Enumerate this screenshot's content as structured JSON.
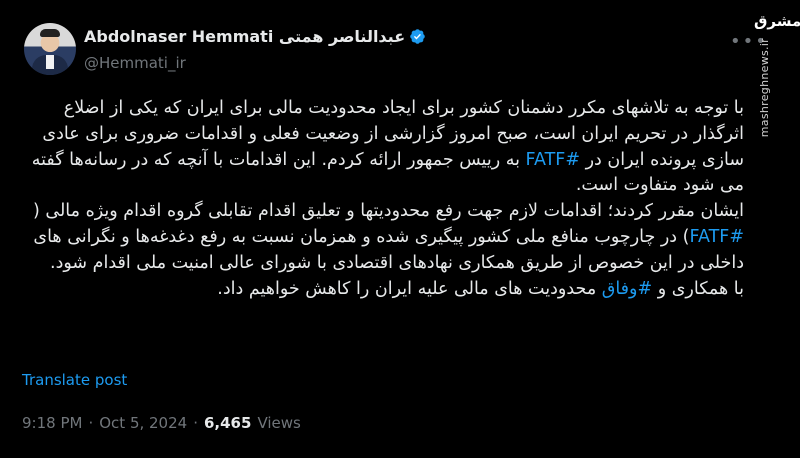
{
  "author": {
    "display_name": "Abdolnaser Hemmati عبدالناصر همتی",
    "handle": "@Hemmati_ir"
  },
  "more_icon": "more-options-icon",
  "verified_icon": "verified-badge-icon",
  "watermark": {
    "logo": "مشرق",
    "url": "mashreghnews.ir"
  },
  "tweet": {
    "p1_a": "با توجه به تلاشهای مکرر دشمنان کشور برای ایجاد محدودیت مالی برای ایران که یکی از اضلاع اثرگذار در تحریم ایران است، صبح امروز گزارشی از وضعیت فعلی و اقدامات ضروری برای عادی سازی پرونده ایران در ",
    "p1_tag": "#FATF",
    "p1_b": " به رییس جمهور ارائه کردم. این اقدامات با آنچه که در رسانه‌ها گفته می شود متفاوت است.",
    "p2_a": "ایشان مقرر کردند؛ اقدامات لازم جهت رفع محدودیتها و تعلیق اقدام تقابلی گروه اقدام ویژه مالی ( ",
    "p2_tag": "#FATF",
    "p2_b": ") در چارچوب منافع ملی کشور پیگیری شده و همزمان نسبت به رفع دغدغه‌ها و نگرانی های داخلی در این خصوص از طریق همکاری نهادهای اقتصادی با شورای عالی امنیت ملی اقدام شود.",
    "p3_a": "با همکاری و ",
    "p3_tag": "#وفاق",
    "p3_b": " محدودیت های مالی علیه ایران را کاهش خواهیم داد."
  },
  "translate_label": "Translate post",
  "meta": {
    "time": "9:18 PM",
    "separator": "·",
    "date": "Oct 5, 2024",
    "views_count": "6,465",
    "views_label": "Views"
  },
  "colors": {
    "background": "#000000",
    "text": "#e7e9ea",
    "muted": "#71767b",
    "link": "#1d9bf0"
  }
}
